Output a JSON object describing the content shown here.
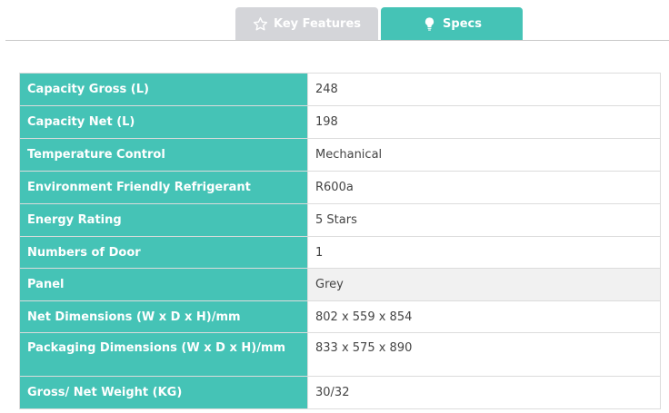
{
  "tabs": {
    "key_features": {
      "label": "Key Features",
      "icon": "star-icon"
    },
    "specs": {
      "label": "Specs",
      "icon": "lightbulb-icon"
    }
  },
  "colors": {
    "accent": "#45c3b6",
    "inactive_tab": "#d4d5d9",
    "shaded_row": "#f1f1f1"
  },
  "specs": [
    {
      "label": "Capacity Gross (L)",
      "value": "248"
    },
    {
      "label": "Capacity Net (L)",
      "value": "198"
    },
    {
      "label": "Temperature Control",
      "value": "Mechanical"
    },
    {
      "label": "Environment Friendly Refrigerant",
      "value": "R600a"
    },
    {
      "label": "Energy Rating",
      "value": "5 Stars"
    },
    {
      "label": "Numbers of Door",
      "value": "1"
    },
    {
      "label": "Panel",
      "value": "Grey"
    },
    {
      "label": "Net Dimensions (W x D x H)/mm",
      "value": "802 x 559 x 854"
    },
    {
      "label": "Packaging Dimensions (W x D x H)/mm",
      "value": "833 x 575 x 890"
    },
    {
      "label": "Gross/ Net Weight (KG)",
      "value": "30/32"
    }
  ]
}
